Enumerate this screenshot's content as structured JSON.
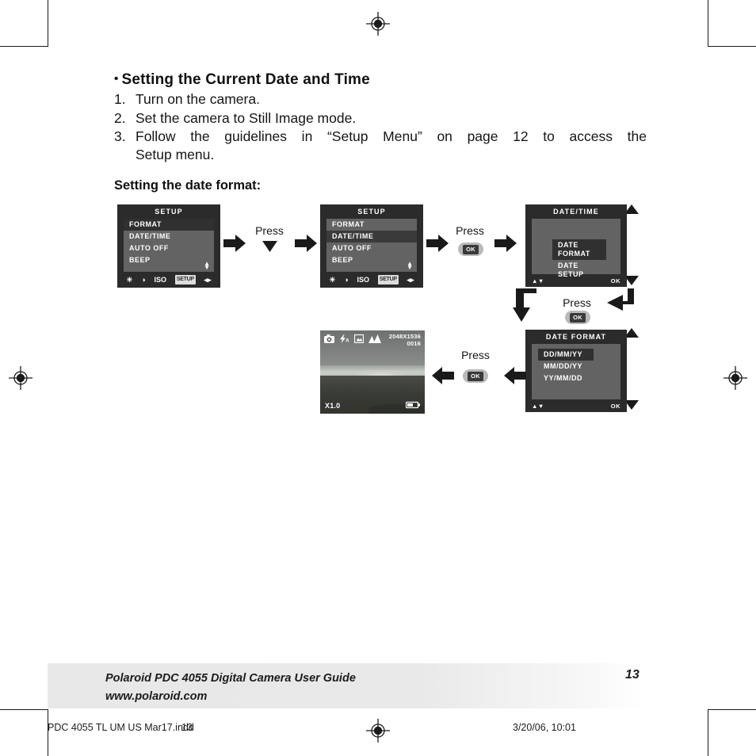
{
  "page": {
    "heading": "Setting the Current Date and Time",
    "heading_bullet": "•",
    "subheading": "Setting the date format:",
    "steps": [
      {
        "num": "1.",
        "text": "Turn on the camera."
      },
      {
        "num": "2.",
        "text": "Set the camera to Still Image mode."
      },
      {
        "num": "3.",
        "text": "Follow the guidelines in “Setup Menu” on page 12 to access the",
        "text2": "Setup menu."
      }
    ]
  },
  "screens": {
    "setup1": {
      "title": "SETUP",
      "items": [
        "FORMAT",
        "DATE/TIME",
        "AUTO OFF",
        "BEEP"
      ],
      "selected": "FORMAT",
      "scroll_indicator": "▲▼",
      "bottom_icons": [
        "☀",
        "◑",
        "ISO",
        "SETUP",
        "◂▸"
      ]
    },
    "setup2": {
      "title": "SETUP",
      "items": [
        "FORMAT",
        "DATE/TIME",
        "AUTO OFF",
        "BEEP"
      ],
      "selected": "DATE/TIME",
      "scroll_indicator": "▲▼",
      "bottom_icons": [
        "☀",
        "◑",
        "ISO",
        "SETUP",
        "◂▸"
      ]
    },
    "datetime": {
      "title": "DATE/TIME",
      "items": [
        "DATE FORMAT",
        "DATE SETUP"
      ],
      "selected": "DATE FORMAT",
      "foot_left": "▲▼",
      "foot_right": "OK"
    },
    "dateformat": {
      "title": "DATE FORMAT",
      "items": [
        "DD/MM/YY",
        "MM/DD/YY",
        "YY/MM/DD"
      ],
      "selected": "DD/MM/YY",
      "foot_left": "▲▼",
      "foot_right": "OK"
    },
    "preview": {
      "icons": [
        "camera-icon",
        "flash-auto-icon",
        "white-balance-icon",
        "landscape-icon"
      ],
      "flash_label": "A",
      "resolution": "2048X1536",
      "shots_remaining": "0016",
      "zoom": "X1.0",
      "battery": "battery-icon"
    }
  },
  "flow": {
    "press_label": "Press",
    "ok_label": "OK",
    "steps": [
      {
        "label": "Press",
        "control": "down-arrow"
      },
      {
        "label": "Press",
        "control": "ok-button"
      },
      {
        "label": "Press",
        "control": "ok-button"
      },
      {
        "label": "Press",
        "control": "ok-button"
      }
    ]
  },
  "footer": {
    "line1": "Polaroid PDC 4055 Digital Camera User Guide",
    "line2": "www.polaroid.com",
    "page_number": "13",
    "print_filename": "PDC 4055 TL UM US Mar17.indd",
    "print_overlay": "13",
    "print_timestamp": "3/20/06, 10:01"
  }
}
